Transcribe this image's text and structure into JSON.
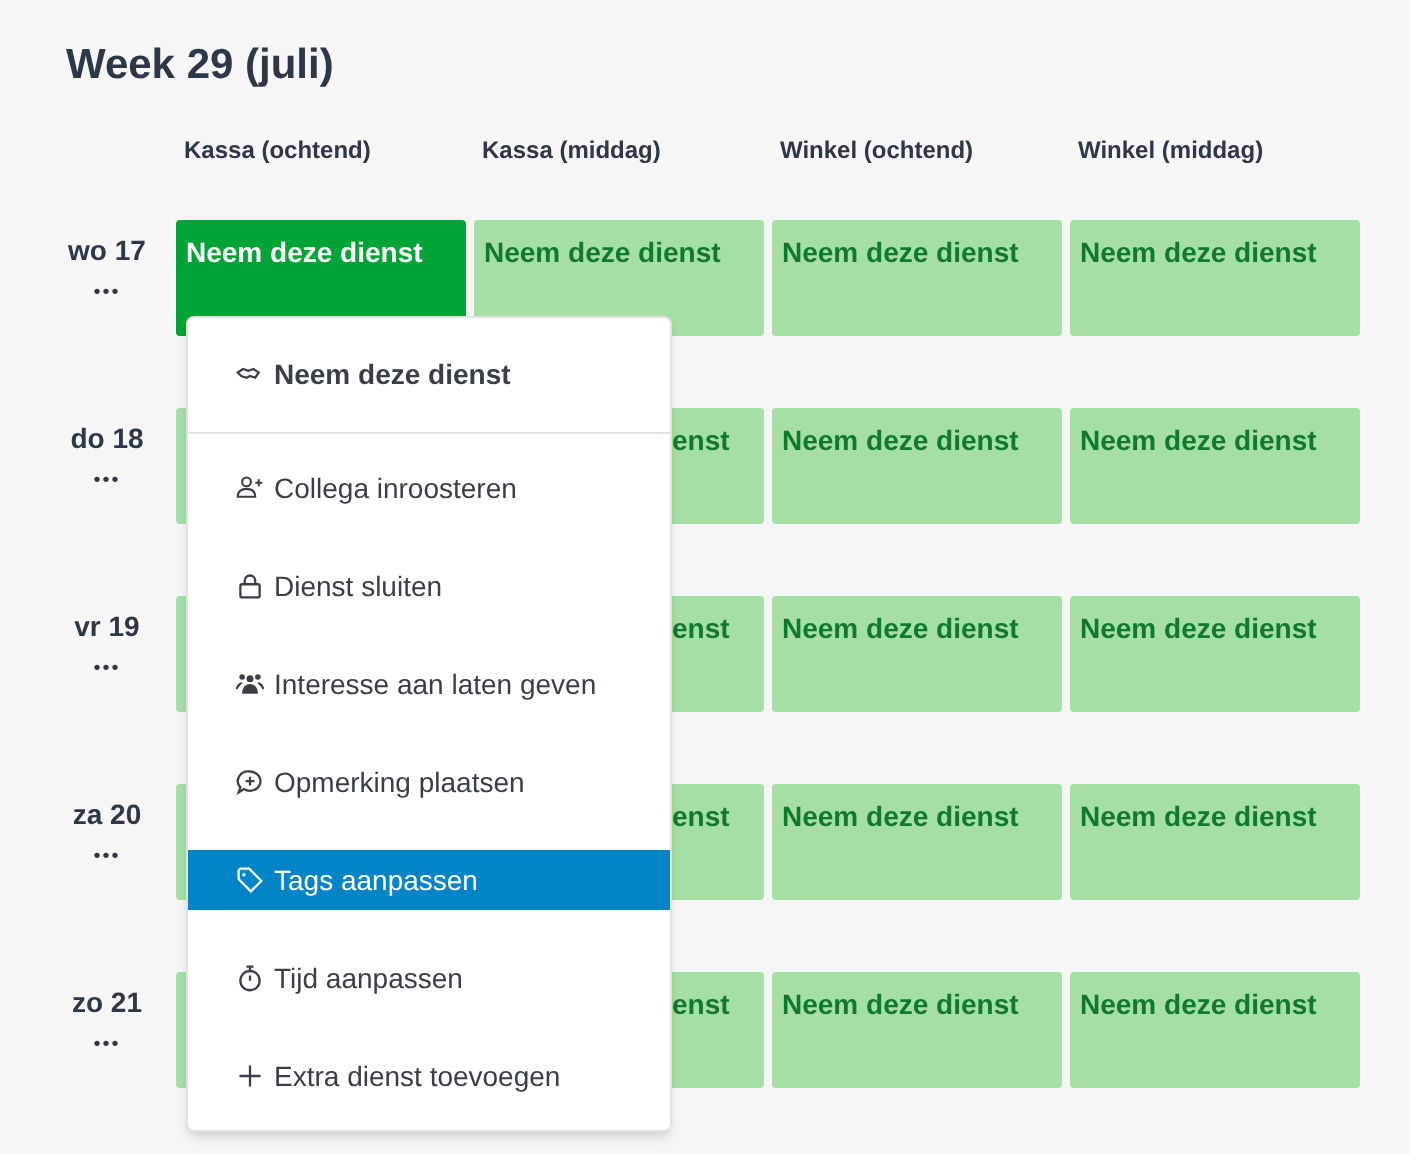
{
  "title": "Week 29 (juli)",
  "columns": [
    "Kassa (ochtend)",
    "Kassa (middag)",
    "Winkel (ochtend)",
    "Winkel (middag)"
  ],
  "days": [
    {
      "label": "wo 17",
      "more": "•••",
      "cells": [
        {
          "text": "Neem deze dienst",
          "selected": true
        },
        {
          "text": "Neem deze dienst",
          "selected": false
        },
        {
          "text": "Neem deze dienst",
          "selected": false
        },
        {
          "text": "Neem deze dienst",
          "selected": false
        }
      ]
    },
    {
      "label": "do 18",
      "more": "•••",
      "cells": [
        {
          "selected": false
        },
        {
          "text": "enst",
          "selected": false
        },
        {
          "text": "Neem deze dienst",
          "selected": false
        },
        {
          "text": "Neem deze dienst",
          "selected": false
        }
      ]
    },
    {
      "label": "vr 19",
      "more": "•••",
      "cells": [
        {
          "selected": false
        },
        {
          "text": "enst",
          "selected": false
        },
        {
          "text": "Neem deze dienst",
          "selected": false
        },
        {
          "text": "Neem deze dienst",
          "selected": false
        }
      ]
    },
    {
      "label": "za 20",
      "more": "•••",
      "cells": [
        {
          "selected": false
        },
        {
          "text": "enst",
          "selected": false
        },
        {
          "text": "Neem deze dienst",
          "selected": false
        },
        {
          "text": "Neem deze dienst",
          "selected": false
        }
      ]
    },
    {
      "label": "zo 21",
      "more": "•••",
      "cells": [
        {
          "selected": false
        },
        {
          "text": "enst",
          "selected": false
        },
        {
          "text": "Neem deze dienst",
          "selected": false
        },
        {
          "text": "Neem deze dienst",
          "selected": false
        }
      ]
    }
  ],
  "menu": [
    {
      "kind": "header",
      "label": "Neem deze dienst",
      "selected": false
    },
    {
      "kind": "item",
      "label": "Collega inroosteren",
      "selected": false
    },
    {
      "kind": "item",
      "label": "Dienst sluiten",
      "selected": false
    },
    {
      "kind": "item",
      "label": "Interesse aan laten geven",
      "selected": false
    },
    {
      "kind": "item",
      "label": "Opmerking plaatsen",
      "selected": false
    },
    {
      "kind": "item",
      "label": "Tags aanpassen",
      "selected": true
    },
    {
      "kind": "item",
      "label": "Tijd aanpassen",
      "selected": false
    },
    {
      "kind": "item",
      "label": "Extra dienst toevoegen",
      "selected": false
    }
  ]
}
